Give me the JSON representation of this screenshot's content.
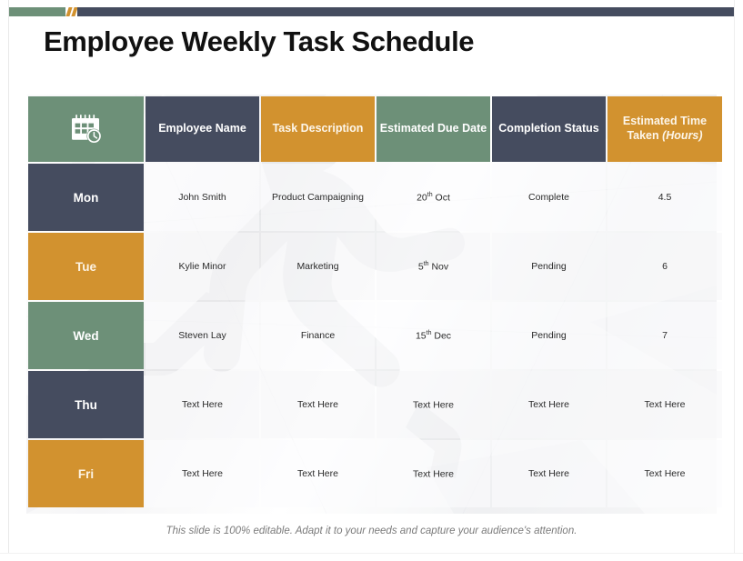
{
  "slide": {
    "title": "Employee Weekly Task Schedule",
    "footer_note": "This slide is 100% editable. Adapt it to your needs and capture your audience's attention."
  },
  "accent_bar": {
    "green": "#6d9078",
    "navy": "#454c5f",
    "orange": "#d2922f"
  },
  "palette": {
    "green": "#6d9078",
    "navy": "#454c5f",
    "orange": "#d2922f",
    "header_text": "#ffffff",
    "body_text": "#2a2a2a",
    "footer_text": "#7b7b7b"
  },
  "table": {
    "header": {
      "day_icon": "calendar-clock-icon",
      "columns": [
        {
          "label": "Employee Name",
          "color": "navy"
        },
        {
          "label": "Task Description",
          "color": "orange"
        },
        {
          "label": "Estimated Due Date",
          "color": "green"
        },
        {
          "label": "Completion Status",
          "color": "navy"
        },
        {
          "label": "Estimated Time Taken ",
          "label_italic": "(Hours)",
          "color": "orange"
        }
      ]
    },
    "rows": [
      {
        "day": "Mon",
        "day_color": "navy",
        "employee_name": "John  Smith",
        "task_description": "Product Campaigning",
        "due_day": "20",
        "due_suffix": "th",
        "due_month": " Oct",
        "completion_status": "Complete",
        "estimated_time": "4.5"
      },
      {
        "day": "Tue",
        "day_color": "orange",
        "employee_name": "Kylie Minor",
        "task_description": "Marketing",
        "due_day": "5",
        "due_suffix": "th",
        "due_month": " Nov",
        "completion_status": "Pending",
        "estimated_time": "6"
      },
      {
        "day": "Wed",
        "day_color": "green",
        "employee_name": "Steven Lay",
        "task_description": "Finance",
        "due_day": "15",
        "due_suffix": "th",
        "due_month": " Dec",
        "completion_status": "Pending",
        "estimated_time": "7"
      },
      {
        "day": "Thu",
        "day_color": "navy",
        "employee_name": "Text Here",
        "task_description": "Text Here",
        "due_day": "Text Here",
        "due_suffix": "",
        "due_month": "",
        "completion_status": "Text Here",
        "estimated_time": "Text Here"
      },
      {
        "day": "Fri",
        "day_color": "orange",
        "employee_name": "Text Here",
        "task_description": "Text Here",
        "due_day": "Text Here",
        "due_suffix": "",
        "due_month": "",
        "completion_status": "Text Here",
        "estimated_time": "Text Here"
      }
    ]
  }
}
